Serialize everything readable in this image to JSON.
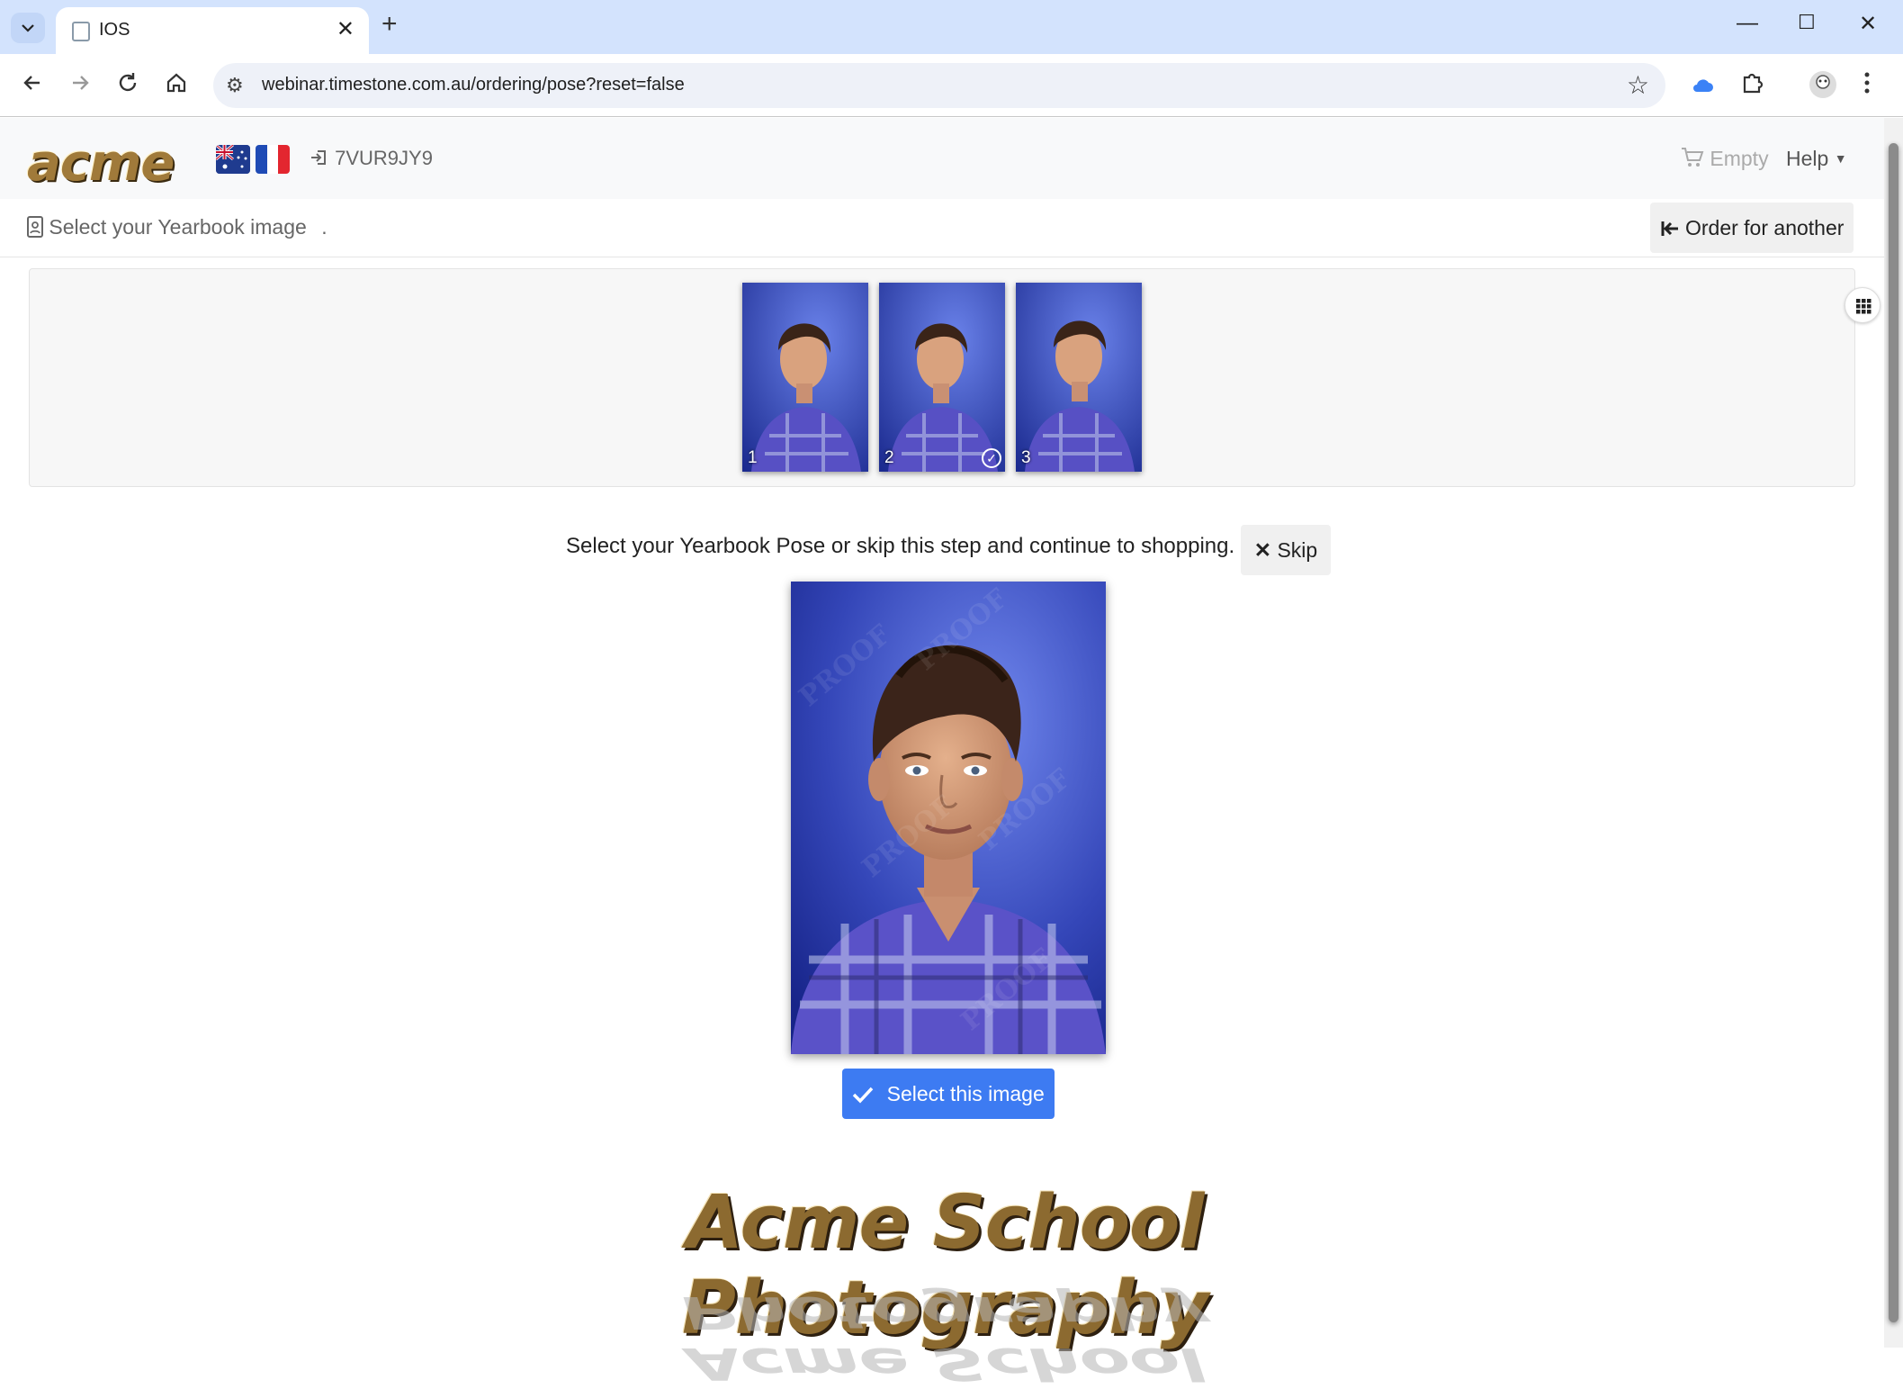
{
  "browser": {
    "tab_title": "IOS",
    "url": "webinar.timestone.com.au/ordering/pose?reset=false"
  },
  "header": {
    "logo_text": "acme",
    "access_code": "7VUR9JY9",
    "cart_label": "Empty",
    "help_label": "Help"
  },
  "subheader": {
    "title": "Select your Yearbook image",
    "order_for_another": "Order for another"
  },
  "gallery": {
    "thumbnails": [
      {
        "number": "1",
        "selected": false
      },
      {
        "number": "2",
        "selected": true
      },
      {
        "number": "3",
        "selected": false
      }
    ]
  },
  "main": {
    "instruction": "Select your Yearbook Pose or skip this step and continue to shopping.",
    "skip_label": "Skip",
    "select_label": "Select this image",
    "watermark": "PROOF"
  },
  "footer": {
    "brand": "Acme School Photography"
  },
  "colors": {
    "primary_button": "#3d7bf2",
    "portrait_background": "#2f3fb0",
    "shirt": "#5a55c8"
  },
  "icons": {
    "cart": "cart-icon",
    "login": "login-icon",
    "person_badge": "person-badge-icon",
    "back_arrow": "arrow-bar-left-icon",
    "grid": "grid-icon",
    "close": "x-icon",
    "check": "check-icon"
  }
}
